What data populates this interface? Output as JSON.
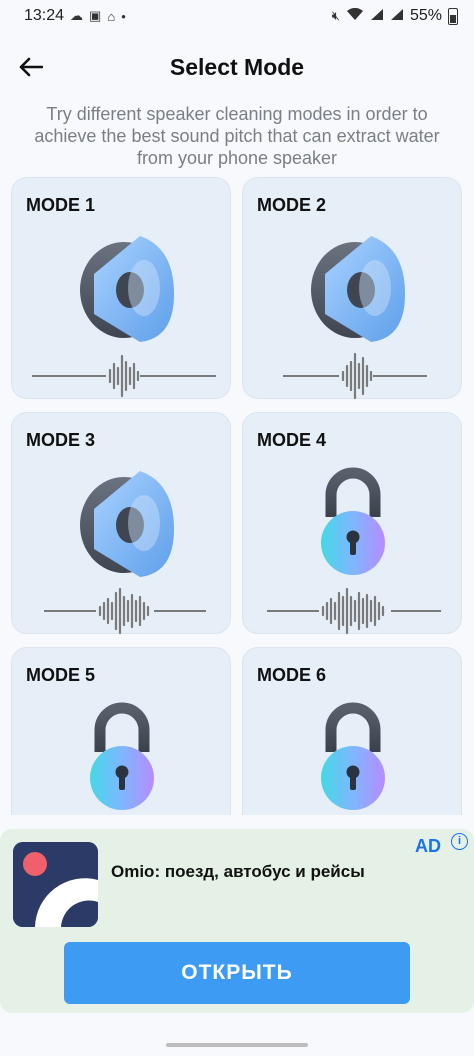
{
  "status_bar": {
    "time": "13:24",
    "battery": "55%",
    "left_icons": [
      "cloud-check-icon",
      "image-icon",
      "home-icon",
      "dot-icon"
    ],
    "right_icons": [
      "mute-icon",
      "wifi-icon",
      "signal-icon",
      "signal-icon",
      "battery-icon"
    ]
  },
  "header": {
    "title": "Select Mode",
    "back_icon": "arrow-left-icon"
  },
  "description": "Try different speaker cleaning modes in order to achieve the best sound pitch that can extract water from your phone speaker",
  "modes": [
    {
      "label": "MODE 1",
      "icon": "speaker-icon",
      "locked": false
    },
    {
      "label": "MODE 2",
      "icon": "speaker-icon",
      "locked": false
    },
    {
      "label": "MODE 3",
      "icon": "speaker-icon",
      "locked": false
    },
    {
      "label": "MODE 4",
      "icon": "lock-icon",
      "locked": true
    },
    {
      "label": "MODE 5",
      "icon": "lock-icon",
      "locked": true
    },
    {
      "label": "MODE 6",
      "icon": "lock-icon",
      "locked": true
    }
  ],
  "ad": {
    "label": "AD",
    "info_icon": "info-icon",
    "app_name": "Omio: поезд, автобус и рейсы",
    "cta": "ОТКРЫТЬ"
  },
  "colors": {
    "card_bg": "#e6eef8",
    "ad_bg": "#e5f1e6",
    "cta": "#3d9bf3",
    "accent": "#1a73e8"
  }
}
